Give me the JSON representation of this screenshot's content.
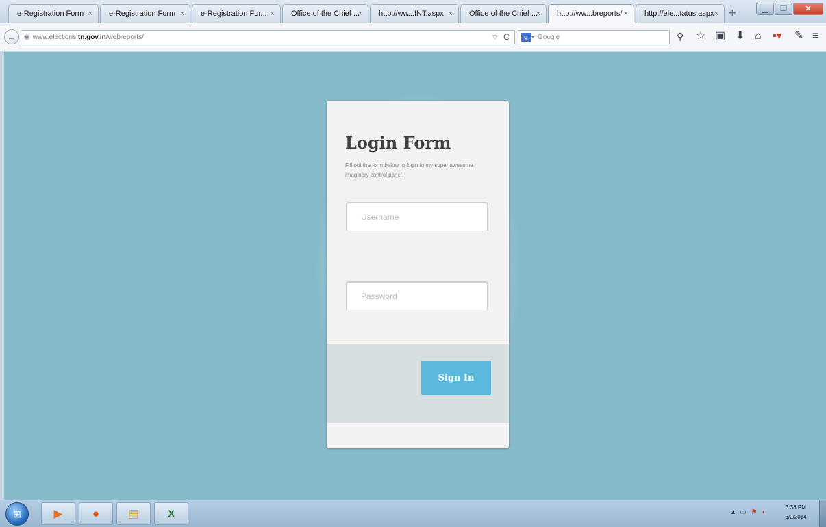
{
  "browser": {
    "tabs": [
      {
        "title": "e-Registration Form"
      },
      {
        "title": "e-Registration Form"
      },
      {
        "title": "e-Registration For..."
      },
      {
        "title": "Office of the Chief ..."
      },
      {
        "title": "http://ww...INT.aspx"
      },
      {
        "title": "Office of the Chief ..."
      },
      {
        "title": "http://ww...breports/"
      },
      {
        "title": "http://ele...tatus.aspx"
      }
    ],
    "tab_close_glyph": "×",
    "new_tab_glyph": "+",
    "url": {
      "prefix": "www.elections.",
      "domain": "tn.gov.in",
      "path": "/webreports/"
    },
    "search": {
      "engine_letter": "g",
      "placeholder": "Google"
    }
  },
  "login": {
    "title": "Login Form",
    "subtitle": "Fill out the form below to login to my super awesome imaginary control panel.",
    "username_placeholder": "Username",
    "password_placeholder": "Password",
    "signin_label": "Sign In"
  },
  "taskbar": {
    "clock_time": "3:38 PM",
    "clock_date": "6/2/2014",
    "excel_label": "X"
  },
  "colors": {
    "page_background": "#87bac8",
    "card_background": "#f2f2f2",
    "card_footer": "#d6dfe0",
    "signin_button": "#5ab9dc"
  }
}
